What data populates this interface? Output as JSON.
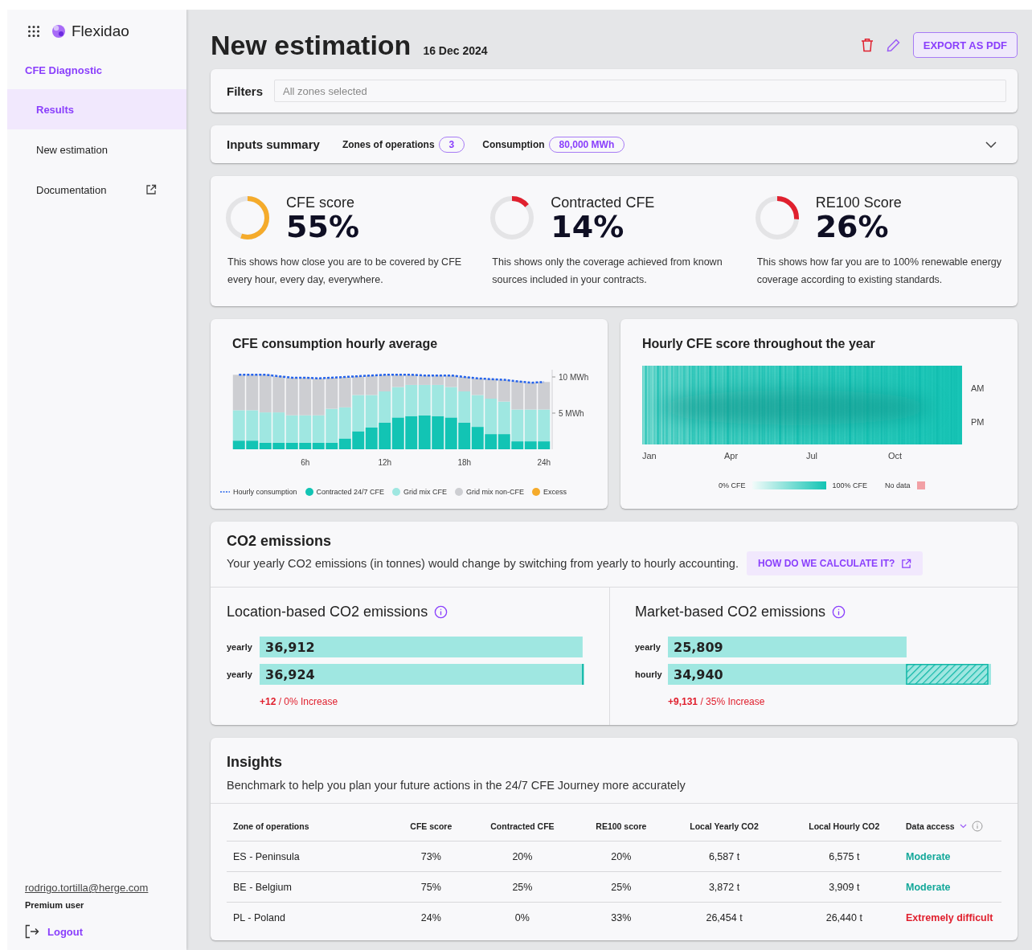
{
  "sidebar": {
    "logo": "Flexidao",
    "section": "CFE Diagnostic",
    "items": [
      {
        "label": "Results",
        "selected": true,
        "external": false
      },
      {
        "label": "New estimation",
        "selected": false,
        "external": false
      },
      {
        "label": "Documentation",
        "selected": false,
        "external": true
      }
    ],
    "user": {
      "email": "rodrigo.tortilla@herge.com",
      "plan": "Premium user"
    },
    "logout": "Logout"
  },
  "header": {
    "title": "New estimation",
    "date": "16 Dec 2024",
    "export_button": "EXPORT AS PDF"
  },
  "filters": {
    "label": "Filters",
    "placeholder": "All zones selected"
  },
  "inputs_summary": {
    "title": "Inputs summary",
    "expanded": false,
    "items": [
      {
        "label": "Zones of operations",
        "value": "3"
      },
      {
        "label": "Consumption",
        "value": "80,000 MWh"
      }
    ]
  },
  "scores": [
    {
      "title": "CFE score",
      "value": "55%",
      "level": 0.55,
      "color": "#f5ab2b",
      "description": "This shows how close you are to be covered by CFE every hour, every day, everywhere."
    },
    {
      "title": "Contracted CFE",
      "value": "14%",
      "level": 0.14,
      "color": "#e0202e",
      "description": "This shows only the coverage achieved from known sources included in your contracts."
    },
    {
      "title": "RE100 Score",
      "value": "26%",
      "level": 0.26,
      "color": "#e0202e",
      "description": "This shows how far you are to 100% renewable energy coverage according to existing standards."
    }
  ],
  "hourly_average": {
    "title": "CFE consumption hourly average",
    "chart_data": {
      "type": "bar",
      "stacked": true,
      "x": [
        1,
        2,
        3,
        4,
        5,
        6,
        7,
        8,
        9,
        10,
        11,
        12,
        13,
        14,
        15,
        16,
        17,
        18,
        19,
        20,
        21,
        22,
        23,
        24
      ],
      "xlim": [
        0.5,
        24.5
      ],
      "ylim": [
        0,
        11
      ],
      "xticks": [
        {
          "value": 6,
          "label": "6h"
        },
        {
          "value": 12,
          "label": "12h"
        },
        {
          "value": 18,
          "label": "18h"
        },
        {
          "value": 24,
          "label": "24h"
        }
      ],
      "yticks": [
        {
          "value": 5,
          "label": "5 MWh"
        },
        {
          "value": 10,
          "label": "10 MWh"
        }
      ],
      "series": [
        {
          "name": "Hourly consumption",
          "type": "line",
          "line_style": "dashed",
          "color": "#2563eb",
          "values": [
            10.3,
            10.3,
            10.3,
            10.1,
            9.9,
            9.9,
            9.8,
            9.9,
            10.0,
            10.1,
            10.2,
            10.3,
            10.3,
            10.3,
            10.2,
            10.2,
            10.2,
            10.0,
            9.8,
            9.7,
            9.6,
            9.4,
            9.2,
            9.3
          ]
        },
        {
          "name": "Contracted 24/7 CFE",
          "color": "#12c4b4",
          "values": [
            1.2,
            1.2,
            0.9,
            0.9,
            0.9,
            0.9,
            0.9,
            0.9,
            1.5,
            2.5,
            3.0,
            3.7,
            4.4,
            4.6,
            4.7,
            4.6,
            4.4,
            3.7,
            3.1,
            2.1,
            2.1,
            1.1,
            1.1,
            1.1
          ]
        },
        {
          "name": "Grid mix CFE",
          "color": "#9fe7e1",
          "values": [
            4.2,
            4.2,
            4.2,
            4.2,
            3.8,
            3.8,
            3.8,
            4.7,
            4.3,
            5.0,
            4.5,
            4.3,
            4.2,
            4.3,
            4.2,
            4.3,
            4.2,
            4.3,
            4.4,
            4.9,
            4.5,
            4.4,
            4.4,
            4.4
          ]
        },
        {
          "name": "Grid mix non-CFE",
          "color": "#cdced2",
          "values": [
            4.9,
            4.9,
            5.2,
            5.0,
            5.2,
            5.2,
            5.1,
            4.3,
            4.2,
            2.6,
            2.7,
            2.3,
            1.7,
            1.4,
            1.3,
            1.3,
            1.6,
            2.0,
            2.3,
            2.7,
            3.0,
            3.9,
            3.7,
            3.8
          ]
        },
        {
          "name": "Excess",
          "color": "#f5ab2b",
          "values": [
            0,
            0,
            0,
            0,
            0,
            0,
            0,
            0,
            0,
            0,
            0,
            0,
            0,
            0,
            0,
            0,
            0,
            0,
            0,
            0,
            0,
            0,
            0,
            0
          ]
        }
      ]
    }
  },
  "heatmap": {
    "title": "Hourly CFE score throughout the year",
    "months": [
      "Jan",
      "Apr",
      "Jul",
      "Oct"
    ],
    "halves": [
      "AM",
      "PM"
    ],
    "legend_low": "0% CFE",
    "legend_high": "100% CFE",
    "no_data": "No data"
  },
  "co2": {
    "title": "CO2 emissions",
    "description": "Your yearly CO2 emissions (in tonnes) would change by switching from yearly to hourly accounting.",
    "link": "HOW DO WE CALCULATE IT?",
    "panels": [
      {
        "title": "Location-based CO2 emissions",
        "chart_data": {
          "type": "bar",
          "orientation": "horizontal",
          "categories": [
            "yearly",
            "yearly"
          ],
          "values": [
            36912,
            36924
          ],
          "value_labels": [
            "36,912",
            "36,924"
          ]
        },
        "change": "**+12** / 0% Increase"
      },
      {
        "title": "Market-based CO2 emissions",
        "chart_data": {
          "type": "bar",
          "orientation": "horizontal",
          "categories": [
            "yearly",
            "hourly"
          ],
          "values": [
            25809,
            34940
          ],
          "value_labels": [
            "25,809",
            "34,940"
          ]
        },
        "change": "**+9,131** / 35% Increase"
      }
    ]
  },
  "insights": {
    "title": "Insights",
    "description": "Benchmark to help you plan your future actions in the 24/7 CFE Journey more accurately",
    "columns": [
      "Zone of operations",
      "CFE score",
      "Contracted CFE",
      "RE100 score",
      "Local Yearly CO2",
      "Local Hourly CO2",
      "Data access"
    ],
    "rows": [
      {
        "cells": [
          "ES - Peninsula",
          "73%",
          "20%",
          "20%",
          "6,587 t",
          "6,575 t"
        ],
        "access": "Moderate",
        "color": "#14a89a"
      },
      {
        "cells": [
          "BE - Belgium",
          "75%",
          "25%",
          "25%",
          "3,872 t",
          "3,909 t"
        ],
        "access": "Moderate",
        "color": "#14a89a"
      },
      {
        "cells": [
          "PL - Poland",
          "24%",
          "0%",
          "33%",
          "26,454 t",
          "26,440 t"
        ],
        "access": "Extremely difficult",
        "color": "#e0202e"
      }
    ]
  }
}
